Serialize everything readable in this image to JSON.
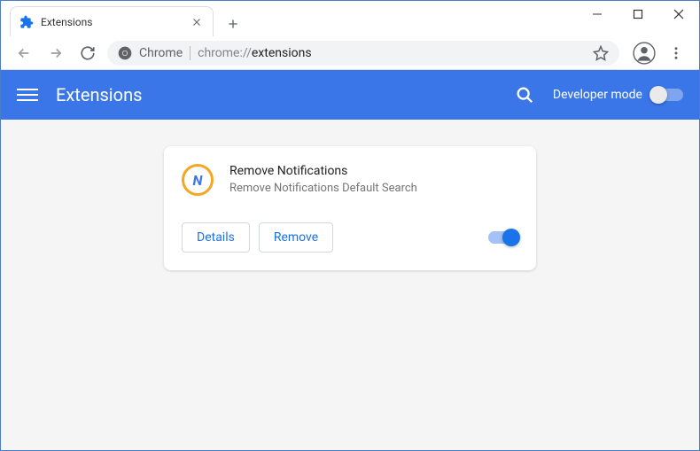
{
  "window": {
    "tab_title": "Extensions",
    "new_tab_label": "+"
  },
  "omnibox": {
    "label": "Chrome",
    "url_prefix": "chrome://",
    "url_path": "extensions"
  },
  "header": {
    "title": "Extensions",
    "dev_mode_label": "Developer mode"
  },
  "extension": {
    "name": "Remove Notifications",
    "description": "Remove Notifications Default Search",
    "details_label": "Details",
    "remove_label": "Remove"
  }
}
